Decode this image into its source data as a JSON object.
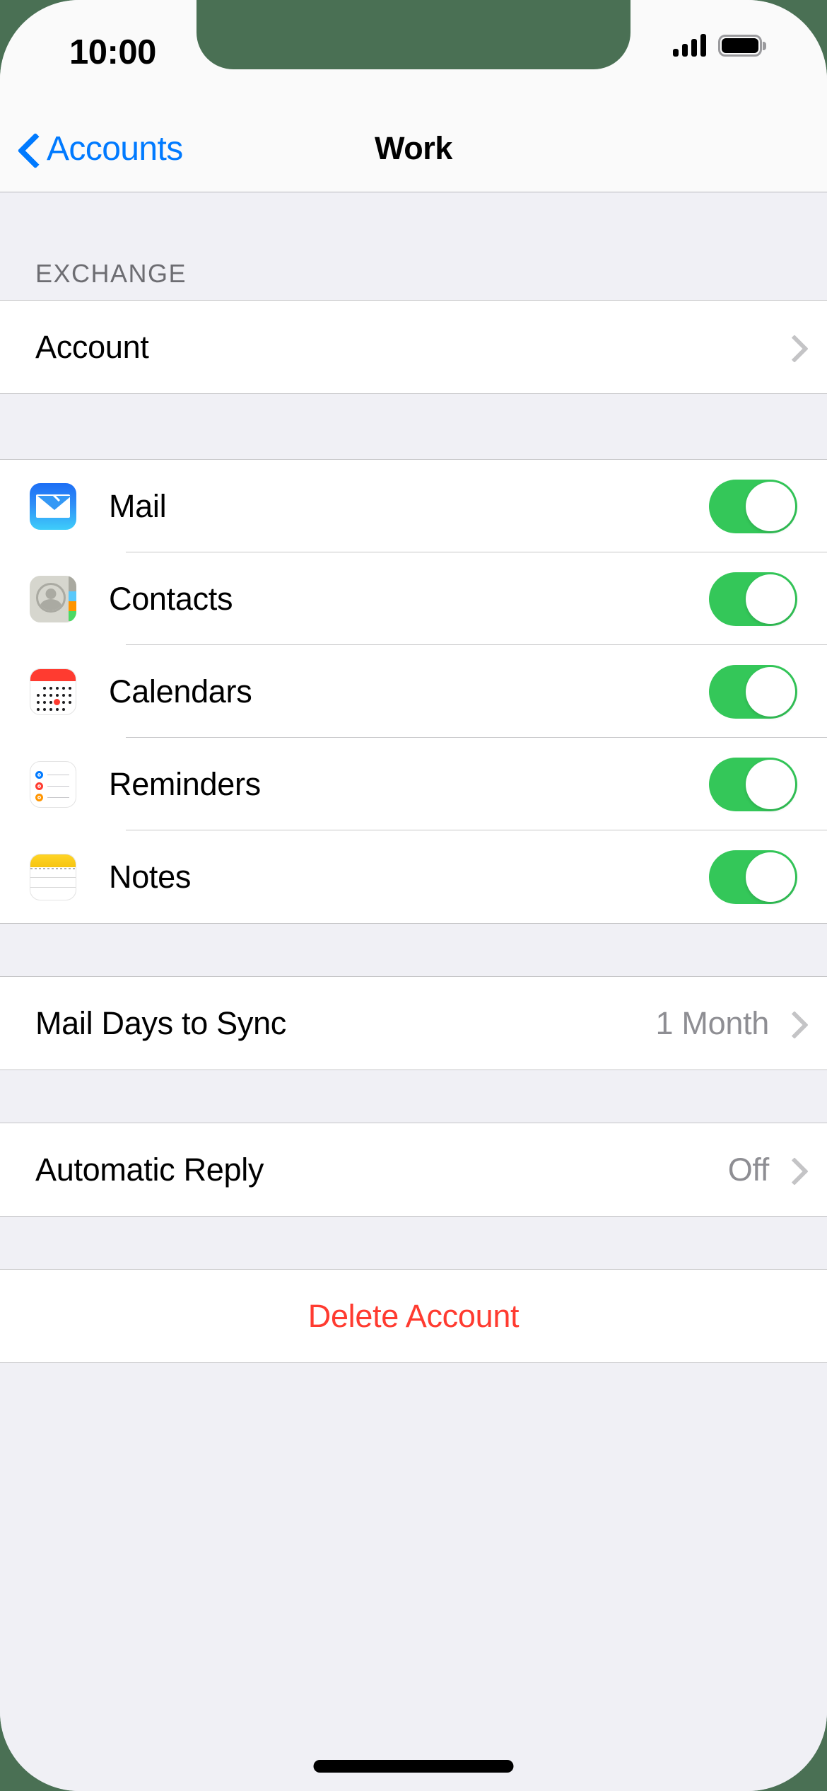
{
  "status_bar": {
    "time": "10:00",
    "signal_icon": "cellular-bars-icon",
    "signal_bars": 4,
    "battery_icon": "battery-full-icon",
    "battery_level": 100
  },
  "nav_bar": {
    "back_label": "Accounts",
    "back_icon": "chevron-left-icon",
    "title": "Work"
  },
  "sections": [
    {
      "header": "EXCHANGE",
      "rows": [
        {
          "label": "Account",
          "type": "disclosure",
          "icon": null,
          "value": ""
        }
      ]
    },
    {
      "header": "",
      "rows": [
        {
          "label": "Mail",
          "type": "toggle",
          "icon": "mail-app-icon",
          "toggle_on": true
        },
        {
          "label": "Contacts",
          "type": "toggle",
          "icon": "contacts-app-icon",
          "toggle_on": true
        },
        {
          "label": "Calendars",
          "type": "toggle",
          "icon": "calendar-app-icon",
          "toggle_on": true
        },
        {
          "label": "Reminders",
          "type": "toggle",
          "icon": "reminders-app-icon",
          "toggle_on": true
        },
        {
          "label": "Notes",
          "type": "toggle",
          "icon": "notes-app-icon",
          "toggle_on": true
        }
      ]
    },
    {
      "header": "",
      "rows": [
        {
          "label": "Mail Days to Sync",
          "type": "disclosure",
          "value": "1 Month"
        }
      ]
    },
    {
      "header": "",
      "rows": [
        {
          "label": "Automatic Reply",
          "type": "disclosure",
          "value": "Off"
        }
      ]
    },
    {
      "header": "",
      "rows": [
        {
          "label": "Delete Account",
          "type": "destructive",
          "value": ""
        }
      ]
    }
  ],
  "rows_flat": {
    "account": {
      "label": "Account"
    },
    "mail": {
      "label": "Mail"
    },
    "contacts": {
      "label": "Contacts"
    },
    "calendars": {
      "label": "Calendars"
    },
    "reminders": {
      "label": "Reminders"
    },
    "notes": {
      "label": "Notes"
    },
    "mail_days": {
      "label": "Mail Days to Sync",
      "value": "1 Month"
    },
    "auto_reply": {
      "label": "Automatic Reply",
      "value": "Off"
    },
    "delete": {
      "label": "Delete Account"
    }
  },
  "colors": {
    "accent_blue": "#007aff",
    "toggle_green": "#34c759",
    "destructive_red": "#ff3b30",
    "group_background": "#f0f0f5",
    "row_background": "#ffffff",
    "secondary_text": "#8e8e93",
    "separator": "#c6c6c8",
    "notch": "#4a7054"
  },
  "home_indicator": "home-indicator"
}
